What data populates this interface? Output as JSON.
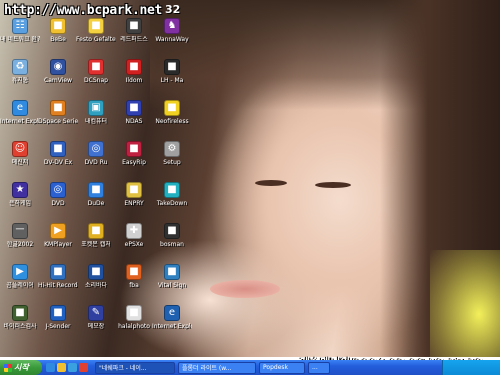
{
  "watermark": "http://www.bcpark.net",
  "top_number": "32",
  "timestamp": "레슬매니아/2004-02-06 18:17:19",
  "desktop_icons": [
    {
      "label": "내 네트워크 환경",
      "glyph": "network-icon",
      "color": "#5aa0e0"
    },
    {
      "label": "BeBe",
      "glyph": "app-icon",
      "color": "#f0c030"
    },
    {
      "label": "Festo Gefaltet",
      "glyph": "app-icon",
      "color": "#f5d040"
    },
    {
      "label": "레드퍼드스",
      "glyph": "app-icon",
      "color": "#404040"
    },
    {
      "label": "WannaWay",
      "glyph": "game-icon",
      "color": "#8030a0"
    },
    {
      "label": "휴지통",
      "glyph": "recycle-bin-icon",
      "color": "#7ab0e0"
    },
    {
      "label": "CamView",
      "glyph": "camera-icon",
      "color": "#3050a0"
    },
    {
      "label": "DCSnap",
      "glyph": "app-icon",
      "color": "#e03030"
    },
    {
      "label": "Ildom",
      "glyph": "app-icon",
      "color": "#d02020"
    },
    {
      "label": "LH - Ma",
      "glyph": "app-icon",
      "color": "#2a2a2a"
    },
    {
      "label": "Internet Explorer",
      "glyph": "ie-icon",
      "color": "#2f8ae0"
    },
    {
      "label": "DSpace Serie",
      "glyph": "app-icon",
      "color": "#e08020"
    },
    {
      "label": "내컴퓨터",
      "glyph": "computer-icon",
      "color": "#30a0c0"
    },
    {
      "label": "NDAS",
      "glyph": "app-icon",
      "color": "#3040b0"
    },
    {
      "label": "Neofireless",
      "glyph": "app-icon",
      "color": "#f0d020"
    },
    {
      "label": "메신저",
      "glyph": "messenger-icon",
      "color": "#e04030"
    },
    {
      "label": "DV-DV Ex",
      "glyph": "app-icon",
      "color": "#3060c0"
    },
    {
      "label": "DVD Ru",
      "glyph": "dvd-icon",
      "color": "#4070d0"
    },
    {
      "label": "EasyRip",
      "glyph": "app-icon",
      "color": "#c02040"
    },
    {
      "label": "Setup",
      "glyph": "setup-icon",
      "color": "#a0a0a0"
    },
    {
      "label": "은하게임",
      "glyph": "star-icon",
      "color": "#4030a0"
    },
    {
      "label": "DVD",
      "glyph": "dvd-icon",
      "color": "#2a60d0"
    },
    {
      "label": "DuDe",
      "glyph": "app-icon",
      "color": "#3080e0"
    },
    {
      "label": "ENPRY",
      "glyph": "app-icon",
      "color": "#e0c040"
    },
    {
      "label": "TakeDown",
      "glyph": "app-icon",
      "color": "#20b0c0"
    },
    {
      "label": "한글2002",
      "glyph": "hwp-icon",
      "color": "#606060"
    },
    {
      "label": "KMPlayer",
      "glyph": "player-icon",
      "color": "#f0a020"
    },
    {
      "label": "포켓몬 캡처",
      "glyph": "app-icon",
      "color": "#e0b020"
    },
    {
      "label": "ePSXe",
      "glyph": "gamepad-icon",
      "color": "#d0d0d0"
    },
    {
      "label": "bosman",
      "glyph": "app-icon",
      "color": "#303030"
    },
    {
      "label": "곰플레이어",
      "glyph": "player-icon",
      "color": "#3090e0"
    },
    {
      "label": "Hi-Hit Recorder",
      "glyph": "app-icon",
      "color": "#3070c0"
    },
    {
      "label": "소리바다",
      "glyph": "app-icon",
      "color": "#2050a0"
    },
    {
      "label": "fba",
      "glyph": "app-icon",
      "color": "#e06020"
    },
    {
      "label": "Vital Sign",
      "glyph": "app-icon",
      "color": "#3080c0"
    },
    {
      "label": "바이러스검사",
      "glyph": "app-icon",
      "color": "#406030"
    },
    {
      "label": "J-Sender",
      "glyph": "app-icon",
      "color": "#2060c0"
    },
    {
      "label": "메모장",
      "glyph": "notepad-icon",
      "color": "#3040a0"
    },
    {
      "label": "halalphoto",
      "glyph": "app-icon",
      "color": "#e0e0e0"
    },
    {
      "label": "Internet Explor...",
      "glyph": "ie-icon",
      "color": "#2060b0"
    }
  ],
  "taskbar": {
    "start_label": "시작",
    "quick_launch": [
      "#2f8ae0",
      "#f0c030",
      "#3aa0e0",
      "#e04030"
    ],
    "tasks": [
      {
        "label": "\"네쉐파크 - 네이..."
      },
      {
        "label": "플롬더 라이트 (w..."
      },
      {
        "label": "Popdesk"
      },
      {
        "label": "..."
      }
    ]
  }
}
